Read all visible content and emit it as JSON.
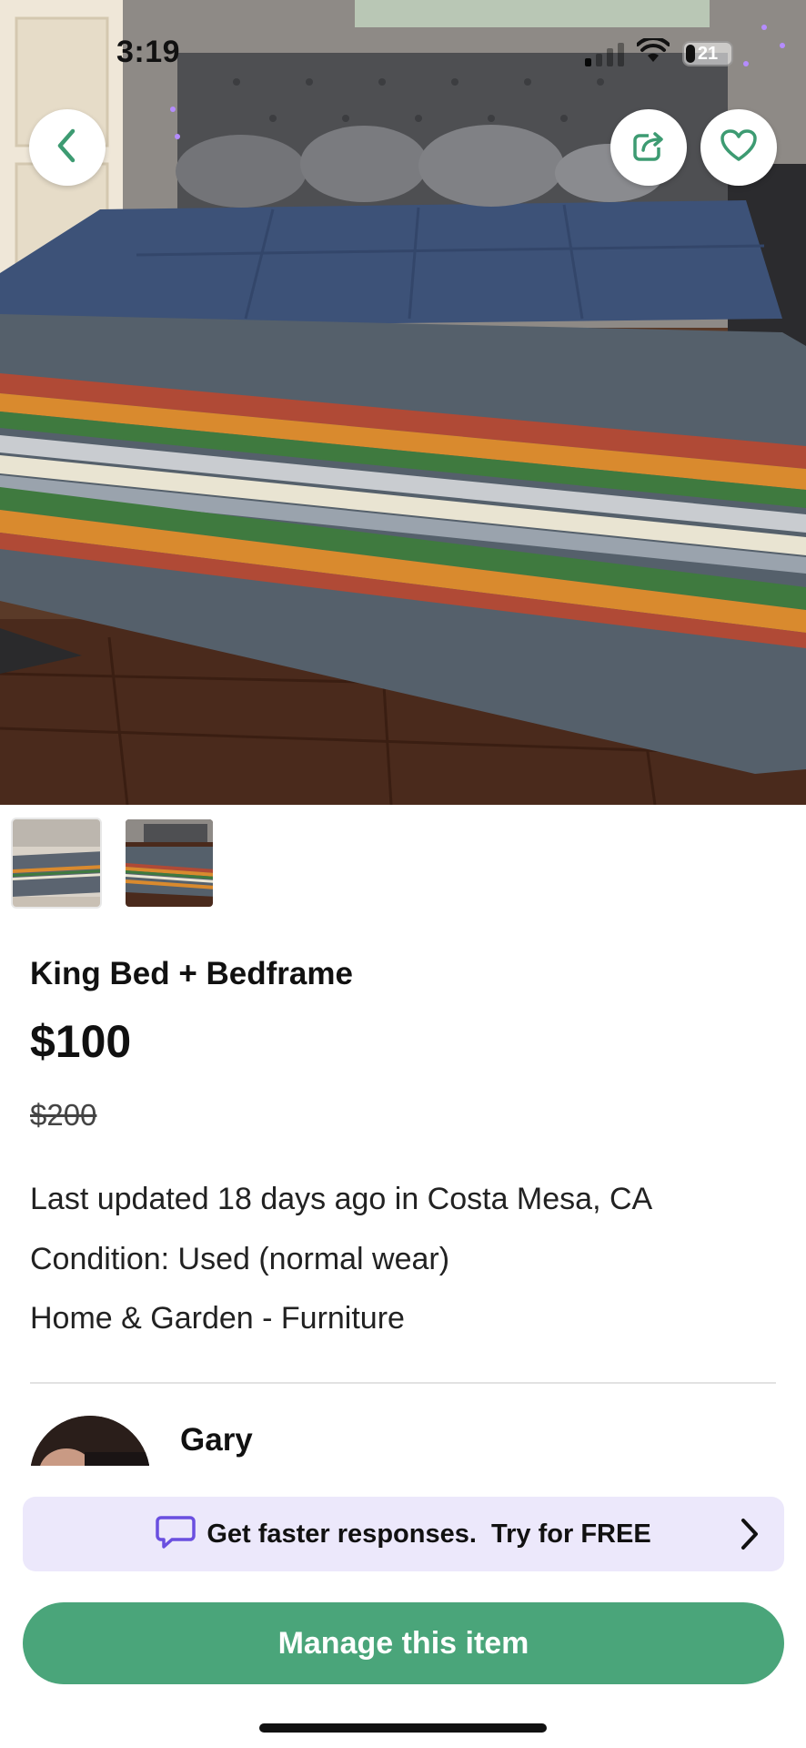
{
  "status_bar": {
    "time": "3:19",
    "battery": "21"
  },
  "header": {
    "back_icon": "chevron-left-icon",
    "share_icon": "share-icon",
    "favorite_icon": "heart-icon"
  },
  "gallery": {
    "thumbnail_count": 2,
    "selected_index": 0
  },
  "listing": {
    "title": "King Bed + Bedframe",
    "price": "$100",
    "original_price": "$200",
    "updated": "Last updated 18 days ago in Costa Mesa, CA",
    "condition": "Condition: Used (normal wear)",
    "category": "Home & Garden - Furniture"
  },
  "seller": {
    "name": "Gary"
  },
  "promo": {
    "text": "Get faster responses.  Try for FREE",
    "icon": "chat-bubble-icon"
  },
  "actions": {
    "manage_label": "Manage this item"
  },
  "colors": {
    "brand_green": "#4aa57a",
    "promo_bg": "#ece8fb",
    "promo_icon": "#6a4fe0"
  }
}
